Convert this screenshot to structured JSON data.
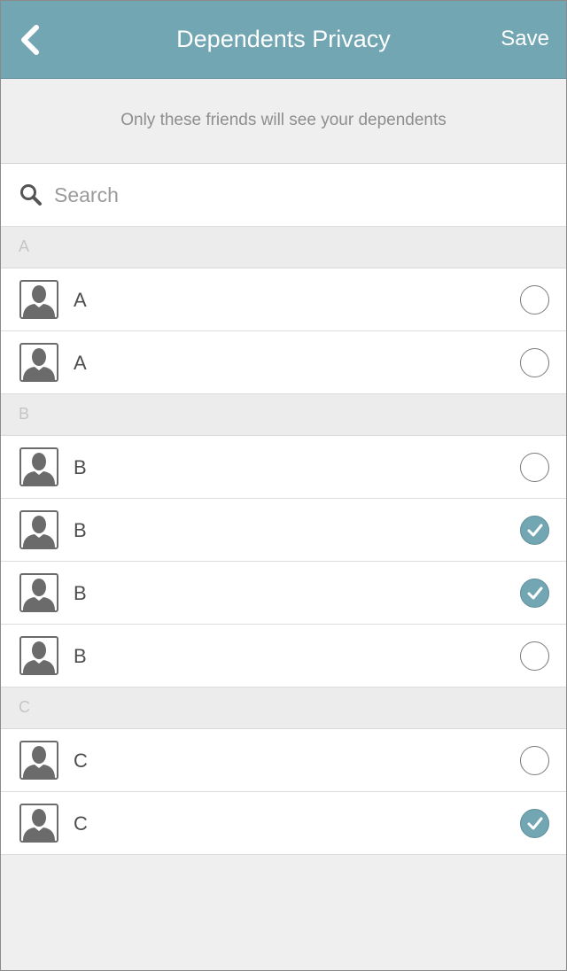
{
  "header": {
    "title": "Dependents Privacy",
    "save_label": "Save",
    "back_icon": "chevron-left-icon",
    "bar_color": "#72a6b3"
  },
  "info_text": "Only these friends will see your dependents",
  "search": {
    "placeholder": "Search",
    "value": "",
    "icon": "search-icon"
  },
  "sections": [
    {
      "letter": "A",
      "items": [
        {
          "name": "A",
          "selected": false
        },
        {
          "name": "A",
          "selected": false
        }
      ]
    },
    {
      "letter": "B",
      "items": [
        {
          "name": "B",
          "selected": false
        },
        {
          "name": "B",
          "selected": true
        },
        {
          "name": "B",
          "selected": true
        },
        {
          "name": "B",
          "selected": false
        }
      ]
    },
    {
      "letter": "C",
      "items": [
        {
          "name": "C",
          "selected": false
        },
        {
          "name": "C",
          "selected": true
        }
      ]
    }
  ],
  "colors": {
    "accent": "#72a6b3",
    "selected_fill": "#72a6b3"
  }
}
